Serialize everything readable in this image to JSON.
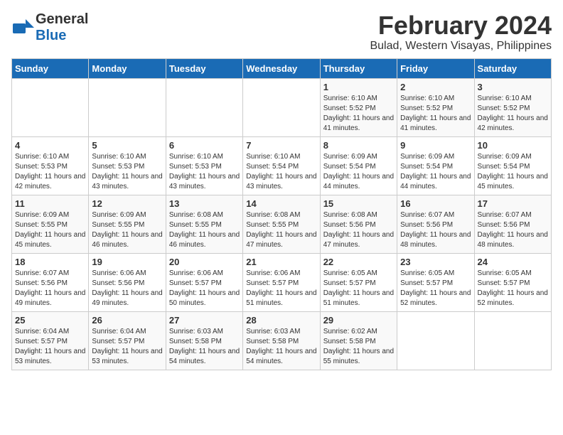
{
  "logo": {
    "line1": "General",
    "line2": "Blue"
  },
  "title": "February 2024",
  "subtitle": "Bulad, Western Visayas, Philippines",
  "days_of_week": [
    "Sunday",
    "Monday",
    "Tuesday",
    "Wednesday",
    "Thursday",
    "Friday",
    "Saturday"
  ],
  "weeks": [
    [
      {
        "day": "",
        "sunrise": "",
        "sunset": "",
        "daylight": ""
      },
      {
        "day": "",
        "sunrise": "",
        "sunset": "",
        "daylight": ""
      },
      {
        "day": "",
        "sunrise": "",
        "sunset": "",
        "daylight": ""
      },
      {
        "day": "",
        "sunrise": "",
        "sunset": "",
        "daylight": ""
      },
      {
        "day": "1",
        "sunrise": "Sunrise: 6:10 AM",
        "sunset": "Sunset: 5:52 PM",
        "daylight": "Daylight: 11 hours and 41 minutes."
      },
      {
        "day": "2",
        "sunrise": "Sunrise: 6:10 AM",
        "sunset": "Sunset: 5:52 PM",
        "daylight": "Daylight: 11 hours and 41 minutes."
      },
      {
        "day": "3",
        "sunrise": "Sunrise: 6:10 AM",
        "sunset": "Sunset: 5:52 PM",
        "daylight": "Daylight: 11 hours and 42 minutes."
      }
    ],
    [
      {
        "day": "4",
        "sunrise": "Sunrise: 6:10 AM",
        "sunset": "Sunset: 5:53 PM",
        "daylight": "Daylight: 11 hours and 42 minutes."
      },
      {
        "day": "5",
        "sunrise": "Sunrise: 6:10 AM",
        "sunset": "Sunset: 5:53 PM",
        "daylight": "Daylight: 11 hours and 43 minutes."
      },
      {
        "day": "6",
        "sunrise": "Sunrise: 6:10 AM",
        "sunset": "Sunset: 5:53 PM",
        "daylight": "Daylight: 11 hours and 43 minutes."
      },
      {
        "day": "7",
        "sunrise": "Sunrise: 6:10 AM",
        "sunset": "Sunset: 5:54 PM",
        "daylight": "Daylight: 11 hours and 43 minutes."
      },
      {
        "day": "8",
        "sunrise": "Sunrise: 6:09 AM",
        "sunset": "Sunset: 5:54 PM",
        "daylight": "Daylight: 11 hours and 44 minutes."
      },
      {
        "day": "9",
        "sunrise": "Sunrise: 6:09 AM",
        "sunset": "Sunset: 5:54 PM",
        "daylight": "Daylight: 11 hours and 44 minutes."
      },
      {
        "day": "10",
        "sunrise": "Sunrise: 6:09 AM",
        "sunset": "Sunset: 5:54 PM",
        "daylight": "Daylight: 11 hours and 45 minutes."
      }
    ],
    [
      {
        "day": "11",
        "sunrise": "Sunrise: 6:09 AM",
        "sunset": "Sunset: 5:55 PM",
        "daylight": "Daylight: 11 hours and 45 minutes."
      },
      {
        "day": "12",
        "sunrise": "Sunrise: 6:09 AM",
        "sunset": "Sunset: 5:55 PM",
        "daylight": "Daylight: 11 hours and 46 minutes."
      },
      {
        "day": "13",
        "sunrise": "Sunrise: 6:08 AM",
        "sunset": "Sunset: 5:55 PM",
        "daylight": "Daylight: 11 hours and 46 minutes."
      },
      {
        "day": "14",
        "sunrise": "Sunrise: 6:08 AM",
        "sunset": "Sunset: 5:55 PM",
        "daylight": "Daylight: 11 hours and 47 minutes."
      },
      {
        "day": "15",
        "sunrise": "Sunrise: 6:08 AM",
        "sunset": "Sunset: 5:56 PM",
        "daylight": "Daylight: 11 hours and 47 minutes."
      },
      {
        "day": "16",
        "sunrise": "Sunrise: 6:07 AM",
        "sunset": "Sunset: 5:56 PM",
        "daylight": "Daylight: 11 hours and 48 minutes."
      },
      {
        "day": "17",
        "sunrise": "Sunrise: 6:07 AM",
        "sunset": "Sunset: 5:56 PM",
        "daylight": "Daylight: 11 hours and 48 minutes."
      }
    ],
    [
      {
        "day": "18",
        "sunrise": "Sunrise: 6:07 AM",
        "sunset": "Sunset: 5:56 PM",
        "daylight": "Daylight: 11 hours and 49 minutes."
      },
      {
        "day": "19",
        "sunrise": "Sunrise: 6:06 AM",
        "sunset": "Sunset: 5:56 PM",
        "daylight": "Daylight: 11 hours and 49 minutes."
      },
      {
        "day": "20",
        "sunrise": "Sunrise: 6:06 AM",
        "sunset": "Sunset: 5:57 PM",
        "daylight": "Daylight: 11 hours and 50 minutes."
      },
      {
        "day": "21",
        "sunrise": "Sunrise: 6:06 AM",
        "sunset": "Sunset: 5:57 PM",
        "daylight": "Daylight: 11 hours and 51 minutes."
      },
      {
        "day": "22",
        "sunrise": "Sunrise: 6:05 AM",
        "sunset": "Sunset: 5:57 PM",
        "daylight": "Daylight: 11 hours and 51 minutes."
      },
      {
        "day": "23",
        "sunrise": "Sunrise: 6:05 AM",
        "sunset": "Sunset: 5:57 PM",
        "daylight": "Daylight: 11 hours and 52 minutes."
      },
      {
        "day": "24",
        "sunrise": "Sunrise: 6:05 AM",
        "sunset": "Sunset: 5:57 PM",
        "daylight": "Daylight: 11 hours and 52 minutes."
      }
    ],
    [
      {
        "day": "25",
        "sunrise": "Sunrise: 6:04 AM",
        "sunset": "Sunset: 5:57 PM",
        "daylight": "Daylight: 11 hours and 53 minutes."
      },
      {
        "day": "26",
        "sunrise": "Sunrise: 6:04 AM",
        "sunset": "Sunset: 5:57 PM",
        "daylight": "Daylight: 11 hours and 53 minutes."
      },
      {
        "day": "27",
        "sunrise": "Sunrise: 6:03 AM",
        "sunset": "Sunset: 5:58 PM",
        "daylight": "Daylight: 11 hours and 54 minutes."
      },
      {
        "day": "28",
        "sunrise": "Sunrise: 6:03 AM",
        "sunset": "Sunset: 5:58 PM",
        "daylight": "Daylight: 11 hours and 54 minutes."
      },
      {
        "day": "29",
        "sunrise": "Sunrise: 6:02 AM",
        "sunset": "Sunset: 5:58 PM",
        "daylight": "Daylight: 11 hours and 55 minutes."
      },
      {
        "day": "",
        "sunrise": "",
        "sunset": "",
        "daylight": ""
      },
      {
        "day": "",
        "sunrise": "",
        "sunset": "",
        "daylight": ""
      }
    ]
  ]
}
